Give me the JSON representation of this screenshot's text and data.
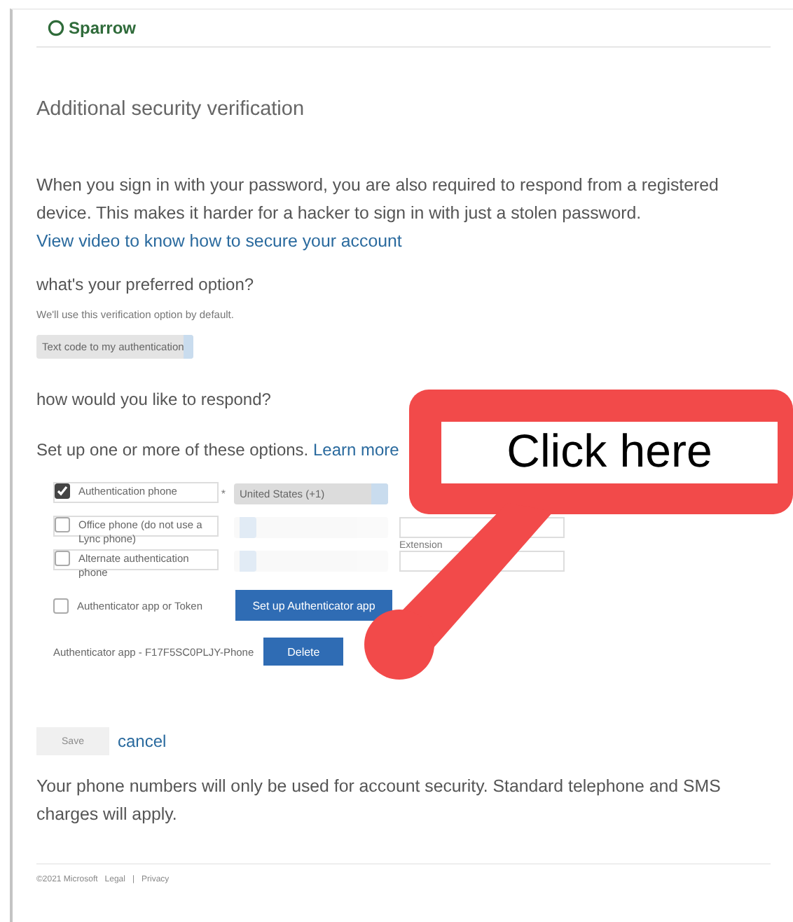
{
  "header": {
    "brand": "Sparrow"
  },
  "title": "Additional security verification",
  "intro": "When you sign in with your password, you are also required to respond from a registered device. This makes it harder for a hacker to sign in with just a stolen password. ",
  "intro_link": "View video to know how to secure your account",
  "preferred": {
    "heading": "what's your preferred option?",
    "hint": "We'll use this verification option by default.",
    "value": "Text code to my authentication"
  },
  "respond_heading": "how would you like to respond?",
  "setup_text": "Set up one or more of these options.",
  "setup_link": "Learn more",
  "options": [
    {
      "kind": "phone",
      "label": "Authentication phone",
      "checked": true,
      "required_mark": "*",
      "country": "United States (+1)",
      "disabled": false,
      "phone_field": false
    },
    {
      "kind": "phone",
      "label": "Office phone (do not use a Lync phone)",
      "checked": false,
      "disabled": true,
      "phone_field": true,
      "extension_label": "Extension"
    },
    {
      "kind": "phone",
      "label": "Alternate authentication phone",
      "checked": false,
      "disabled": true,
      "phone_field": true
    },
    {
      "kind": "app",
      "label": "Authenticator app or Token",
      "checked": false,
      "button": "Set up Authenticator app"
    }
  ],
  "app_entry": {
    "text": "Authenticator app - F17F5SC0PLJY-Phone",
    "button": "Delete"
  },
  "save": {
    "label": "Save",
    "disabled": true
  },
  "cancel": "cancel",
  "notice": "Your phone numbers will only be used for account security. Standard telephone and SMS charges will apply.",
  "footer": "©2021 Microsoft   Legal   |   Privacy",
  "callout": {
    "text": "Click here"
  }
}
